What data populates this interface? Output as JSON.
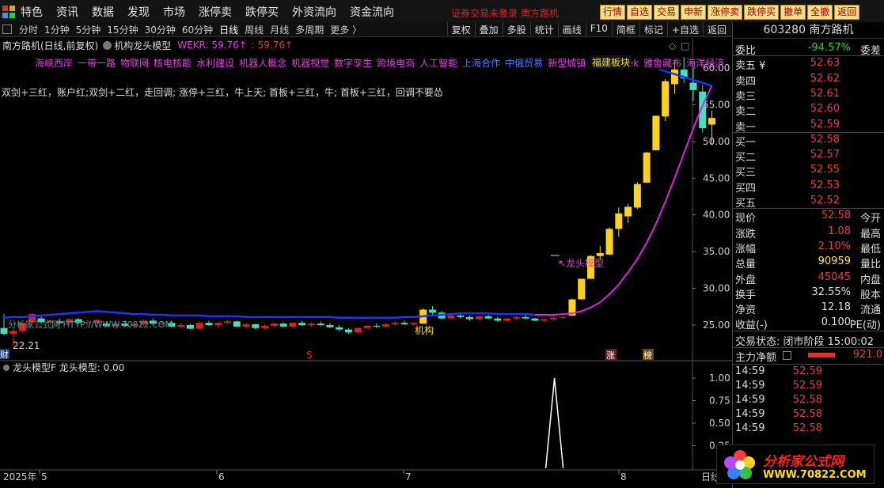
{
  "menu": [
    "特色",
    "资讯",
    "数据",
    "发现",
    "市场",
    "涨停卖",
    "跌停买",
    "外资流向",
    "资金流向"
  ],
  "notice": "证券交易未登录  南方路机",
  "quick_buttons": [
    "行情",
    "自选",
    "交易",
    "申新",
    "涨停卖",
    "跌停买",
    "撤单",
    "全撤",
    "返回"
  ],
  "periods": [
    "分时",
    "1分钟",
    "5分钟",
    "15分钟",
    "30分钟",
    "60分钟",
    "日线",
    "周线",
    "月线",
    "多周期",
    "更多 〉"
  ],
  "active_period": "日线",
  "tools": [
    "复权",
    "叠加",
    "多股",
    "统计",
    "画线",
    "F10",
    "简框",
    "标记",
    "+自选",
    "返回"
  ],
  "chart_header": {
    "name": "南方路机(日线,前复权)",
    "indicator": "机构龙头模型",
    "wekr": "WEKR: 59.76↑",
    "wekr2": ": 59.76↑"
  },
  "concepts": [
    "海峡西岸",
    "一带一路",
    "物联网",
    "核电核能",
    "水利建设",
    "机器人概念",
    "机器视觉",
    "数字孪生",
    "跨境电商",
    "人工智能",
    "上海合作",
    "中俄贸易",
    "新型城镇",
    "DeepSeek",
    "雅鲁藏布",
    "海洋经济"
  ],
  "fuji_label": "福建板块",
  "strategy_text": "双剑+三红，账户红;双剑+二红，走回调;  涨停+三红，牛上天;  首板+三红，牛;  首板+三红，回调不要怂",
  "annotations": {
    "jigou": "机构",
    "longtou": "龙头模型",
    "low_price": "22.21",
    "zhang": "涨",
    "bang": "榜",
    "watermark_text": "分析家公式网 HTTP://WWW.70822.COM",
    "cai": "财",
    "s_mark": "S"
  },
  "price_axis": [
    "60.00",
    "55.00",
    "50.00",
    "45.00",
    "40.00",
    "35.00",
    "30.00",
    "25.00"
  ],
  "sub_header": "龙头模型F  龙头模型: 0.00",
  "sub_axis": [
    "1.00",
    "0.75",
    "0.50",
    "0.25"
  ],
  "x_axis": [
    "2025年",
    "5",
    "6",
    "7",
    "8"
  ],
  "x_axis_right": "日线",
  "quote": {
    "code_name": "603280 南方路机",
    "weibi_label": "委比",
    "weibi": "-94.57%",
    "weicha_label": "委差",
    "sell": [
      {
        "label": "卖五 ¥",
        "price": "52.63"
      },
      {
        "label": "卖四",
        "price": "52.62"
      },
      {
        "label": "卖三",
        "price": "52.61"
      },
      {
        "label": "卖二",
        "price": "52.60"
      },
      {
        "label": "卖一",
        "price": "52.59"
      }
    ],
    "buy": [
      {
        "label": "买一",
        "price": "52.58"
      },
      {
        "label": "买二",
        "price": "52.57"
      },
      {
        "label": "买三",
        "price": "52.55"
      },
      {
        "label": "买四",
        "price": "52.53"
      },
      {
        "label": "买五",
        "price": "52.52"
      }
    ],
    "stats": [
      {
        "l": "现价",
        "v": "52.58",
        "r": "今开",
        "cls": "ret"
      },
      {
        "l": "涨跌",
        "v": "1.08",
        "r": "最高",
        "cls": "ret"
      },
      {
        "l": "涨幅",
        "v": "2.10%",
        "r": "最低",
        "cls": "ret"
      },
      {
        "l": "总量",
        "v": "90959",
        "r": "量比",
        "cls": "yel"
      },
      {
        "l": "外盘",
        "v": "45045",
        "r": "内盘",
        "cls": "ret"
      },
      {
        "l": "换手",
        "v": "32.55%",
        "r": "股本",
        "cls": "wht"
      },
      {
        "l": "净资",
        "v": "12.18",
        "r": "流通",
        "cls": "wht"
      },
      {
        "l": "收益(-)",
        "v": "0.100",
        "r": "PE(动)",
        "cls": "wht"
      }
    ],
    "trade_status": "交易状态: 闭市阶段 15:00:02",
    "main_flow_label": "主力净额",
    "main_flow": "921.0",
    "ticks": [
      {
        "time": "14:59",
        "price": "52.59"
      },
      {
        "time": "14:59",
        "price": "52.59"
      },
      {
        "time": "14:59",
        "price": "52.58"
      },
      {
        "time": "14:59",
        "price": "52.58"
      },
      {
        "time": "14:59",
        "price": "52.58"
      }
    ]
  },
  "watermark": {
    "line1": "分析家公式网",
    "line2": "WWW.70822.COM"
  },
  "chart_data": {
    "type": "candlestick",
    "y_range": [
      22,
      62
    ],
    "sub_series_name": "龙头模型",
    "sub_ylim": [
      0,
      1
    ],
    "candles": [
      [
        24.6,
        26.5,
        23.6,
        23.8
      ],
      [
        23.8,
        24.5,
        22.2,
        24.2
      ],
      [
        24.2,
        25.4,
        24.0,
        25.3
      ],
      [
        25.4,
        26.6,
        25.2,
        26.5
      ],
      [
        25.9,
        26.2,
        25.2,
        25.4
      ],
      [
        25.4,
        25.8,
        25.0,
        25.6
      ],
      [
        25.5,
        25.9,
        25.1,
        25.3
      ],
      [
        25.3,
        25.9,
        25.0,
        25.8
      ],
      [
        25.8,
        26.0,
        25.1,
        25.3
      ],
      [
        25.3,
        25.7,
        24.9,
        25.4
      ],
      [
        25.3,
        25.8,
        24.9,
        25.7
      ],
      [
        25.2,
        25.5,
        24.8,
        24.9
      ],
      [
        24.9,
        25.3,
        24.5,
        25.2
      ],
      [
        25.2,
        25.6,
        24.8,
        24.9
      ],
      [
        24.9,
        25.4,
        24.6,
        25.1
      ],
      [
        25.1,
        25.8,
        24.9,
        25.6
      ],
      [
        25.6,
        25.9,
        25.0,
        25.2
      ],
      [
        25.2,
        25.6,
        24.9,
        25.3
      ],
      [
        25.3,
        25.6,
        24.7,
        24.8
      ],
      [
        24.8,
        25.3,
        24.6,
        25.0
      ],
      [
        25.0,
        25.2,
        24.4,
        24.5
      ],
      [
        24.5,
        25.5,
        24.4,
        25.3
      ],
      [
        25.3,
        25.6,
        24.9,
        25.0
      ],
      [
        25.0,
        25.4,
        24.6,
        25.3
      ],
      [
        25.3,
        25.7,
        25.1,
        25.5
      ],
      [
        25.5,
        25.6,
        24.7,
        24.8
      ],
      [
        24.8,
        25.3,
        24.6,
        25.1
      ],
      [
        25.1,
        25.2,
        24.4,
        24.6
      ],
      [
        24.6,
        25.1,
        24.4,
        24.9
      ],
      [
        24.9,
        25.3,
        24.7,
        25.2
      ],
      [
        25.2,
        25.4,
        24.7,
        24.8
      ],
      [
        24.8,
        25.4,
        24.6,
        25.3
      ],
      [
        25.3,
        25.6,
        24.9,
        25.0
      ],
      [
        25.0,
        25.4,
        24.8,
        25.2
      ],
      [
        25.2,
        25.5,
        24.9,
        25.0
      ],
      [
        25.0,
        25.3,
        24.6,
        24.7
      ],
      [
        24.7,
        25.0,
        24.2,
        24.4
      ],
      [
        24.4,
        24.6,
        23.8,
        24.0
      ],
      [
        24.0,
        24.7,
        23.9,
        24.6
      ],
      [
        24.6,
        25.0,
        24.4,
        24.9
      ],
      [
        24.9,
        25.2,
        24.6,
        24.8
      ],
      [
        24.8,
        25.3,
        24.7,
        25.1
      ],
      [
        25.1,
        25.5,
        24.9,
        25.3
      ],
      [
        25.3,
        25.6,
        25.0,
        25.1
      ],
      [
        25.1,
        25.4,
        24.9,
        25.3
      ],
      [
        25.2,
        27.3,
        25.2,
        27.1
      ],
      [
        27.1,
        27.6,
        26.4,
        26.7
      ],
      [
        26.7,
        26.9,
        25.8,
        25.9
      ],
      [
        25.9,
        26.5,
        25.8,
        26.3
      ],
      [
        26.3,
        26.6,
        25.9,
        26.1
      ],
      [
        26.1,
        26.3,
        25.6,
        25.8
      ],
      [
        25.8,
        26.3,
        25.7,
        26.2
      ],
      [
        26.2,
        26.4,
        25.8,
        25.9
      ],
      [
        25.9,
        26.1,
        25.4,
        25.6
      ],
      [
        25.6,
        26.0,
        25.5,
        25.9
      ],
      [
        25.9,
        26.2,
        25.7,
        26.1
      ],
      [
        26.1,
        26.4,
        25.8,
        25.9
      ],
      [
        25.9,
        26.0,
        25.5,
        25.6
      ],
      [
        25.6,
        25.9,
        25.4,
        25.8
      ],
      [
        25.8,
        26.1,
        25.6,
        26.0
      ],
      [
        26.0,
        26.3,
        25.8,
        26.1
      ],
      [
        26.3,
        28.6,
        26.2,
        28.5
      ],
      [
        28.5,
        31.3,
        28.5,
        31.3
      ],
      [
        31.3,
        34.5,
        31.3,
        34.4
      ],
      [
        34.4,
        35.8,
        33.9,
        34.8
      ],
      [
        34.6,
        38.3,
        34.5,
        38.1
      ],
      [
        38.1,
        41.0,
        37.0,
        40.2
      ],
      [
        39.8,
        41.5,
        38.9,
        41.1
      ],
      [
        41.0,
        44.5,
        40.8,
        44.2
      ],
      [
        44.4,
        48.6,
        44.4,
        48.5
      ],
      [
        48.8,
        53.5,
        48.8,
        53.5
      ],
      [
        53.4,
        58.5,
        52.8,
        58.2
      ],
      [
        57.8,
        61.0,
        56.5,
        59.8
      ],
      [
        59.8,
        61.5,
        58.0,
        58.6
      ],
      [
        58.0,
        60.0,
        55.5,
        57.0
      ],
      [
        56.8,
        57.7,
        51.2,
        51.8
      ],
      [
        52.3,
        54.2,
        49.5,
        53.2
      ]
    ],
    "ma": [
      26.0,
      26.1,
      26.1,
      26.2,
      26.3,
      26.4,
      26.5,
      26.6,
      26.7,
      26.8,
      26.9,
      26.8,
      26.7,
      26.6,
      26.5,
      26.5,
      26.4,
      26.4,
      26.3,
      26.3,
      26.3,
      26.3,
      26.2,
      26.2,
      26.2,
      26.2,
      26.1,
      26.1,
      26.1,
      26.1,
      26.1,
      26.1,
      26.1,
      26.1,
      26.1,
      26.1,
      26.0,
      26.0,
      26.0,
      26.0,
      26.0,
      26.0,
      26.0,
      26.1,
      26.1,
      26.2,
      26.3,
      26.4,
      26.5,
      26.6,
      26.6,
      26.6,
      26.6,
      26.5,
      26.5,
      26.5,
      26.5,
      26.4,
      26.4,
      26.4,
      26.5,
      26.6,
      26.9,
      27.4,
      28.1,
      29.2,
      30.5,
      32.2,
      34.0,
      36.2,
      38.8,
      41.8,
      45.0,
      48.4,
      51.8,
      54.9,
      57.6
    ]
  }
}
